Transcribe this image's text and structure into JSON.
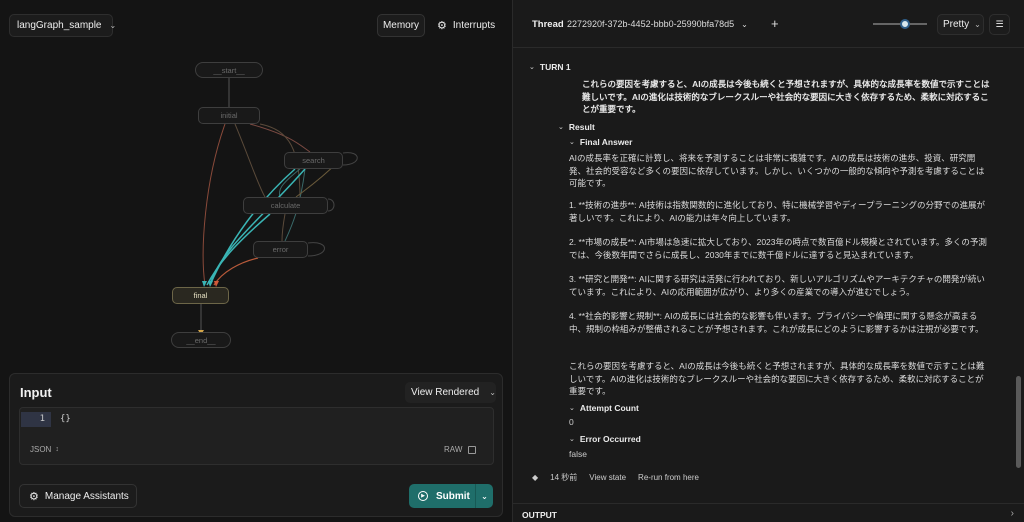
{
  "graph": {
    "selector": "langGraph_sample",
    "memory_label": "Memory",
    "interrupts_label": "Interrupts",
    "nodes": {
      "start": "__start__",
      "initial": "initial",
      "search": "search",
      "calculate": "calculate",
      "error": "error",
      "final": "final",
      "end": "__end__"
    }
  },
  "input": {
    "title": "Input",
    "view_label": "View Rendered",
    "line_no": "1",
    "code": "{}",
    "format": "JSON",
    "raw_label": "RAW",
    "manage_label": "Manage Assistants",
    "submit_label": "Submit"
  },
  "thread": {
    "label": "Thread",
    "id": "2272920f-372b-4452-bbb0-25990bfa78d5",
    "plus": "+",
    "pretty": "Pretty",
    "slider_level": 0.6,
    "turn": "TURN 1",
    "top_text_1": "これらの要因を考慮すると、AIの成長は今後も続くと予想されますが、具体的な成長率を数値で示すことは難しいです。AIの進化は技術的なブレークスルーや社会的な要因に大きく依存するため、柔軟に対応することが重要です。",
    "result_label": "Result",
    "final_answer_label": "Final Answer",
    "p1": "AIの成長率を正確に計算し、将来を予測することは非常に複雑です。AIの成長は技術の進歩、投資、研究開発、社会的受容など多くの要因に依存しています。しかし、いくつかの一般的な傾向や予測を考慮することは可能です。",
    "p2": "1. **技術の進歩**: AI技術は指数関数的に進化しており、特に機械学習やディープラーニングの分野での進展が著しいです。これにより、AIの能力は年々向上しています。",
    "p3": "2. **市場の成長**: AI市場は急速に拡大しており、2023年の時点で数百億ドル規模とされています。多くの予測では、今後数年間でさらに成長し、2030年までに数千億ドルに達すると見込まれています。",
    "p4": "3. **研究と開発**: AIに関する研究は活発に行われており、新しいアルゴリズムやアーキテクチャの開発が続いています。これにより、AIの応用範囲が広がり、より多くの産業での導入が進むでしょう。",
    "p5": "4. **社会的影響と規制**: AIの成長には社会的な影響も伴います。プライバシーや倫理に関する懸念が高まる中、規制の枠組みが整備されることが予想されます。これが成長にどのように影響するかは注視が必要です。",
    "p6": "これらの要因を考慮すると、AIの成長は今後も続くと予想されますが、具体的な成長率を数値で示すことは難しいです。AIの進化は技術的なブレークスルーや社会的な要因に大きく依存するため、柔軟に対応することが重要です。",
    "attempt_label": "Attempt Count",
    "attempt_value": "0",
    "error_label": "Error Occurred",
    "error_value": "false",
    "time_ago": "14 秒前",
    "view_state": "View state",
    "rerun": "Re-run from here",
    "output": "OUTPUT"
  }
}
